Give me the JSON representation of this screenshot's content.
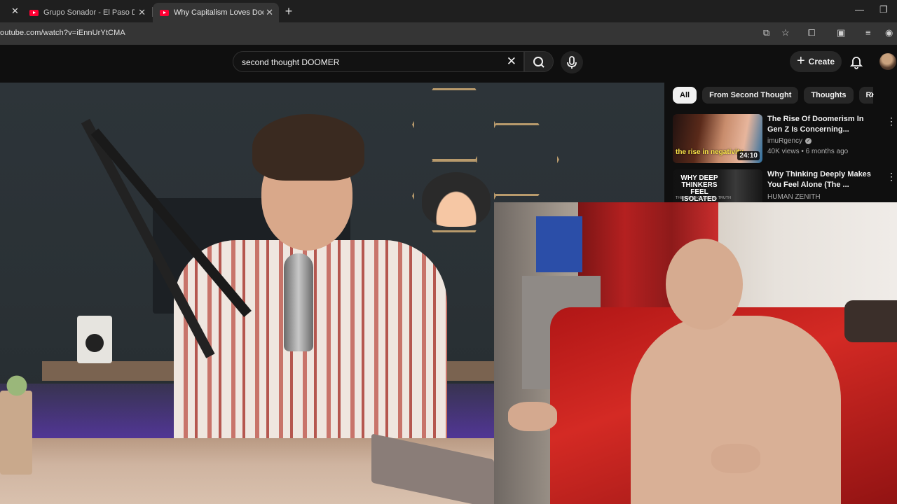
{
  "browser": {
    "tabs": [
      {
        "title": "Grupo Sonador - El Paso Del Gi",
        "active": false
      },
      {
        "title": "Why Capitalism Loves Doomer",
        "active": true
      }
    ],
    "url": "outube.com/watch?v=iEnnUrYtCMA"
  },
  "youtube": {
    "search_value": "second thought DOOMER",
    "create_label": "Create"
  },
  "rail": {
    "chips": [
      "All",
      "From Second Thought",
      "Thoughts",
      "Rela"
    ],
    "recommendations": [
      {
        "title": "The Rise Of Doomerism In Gen Z Is Concerning...",
        "channel": "imuRgency",
        "verified": true,
        "meta": "40K views • 6 months ago",
        "duration": "24:10",
        "thumb_text": "the rise in negativity"
      },
      {
        "title": "Why Thinking Deeply Makes You Feel Alone (The ...",
        "channel": "HUMAN ZENITH",
        "verified": false,
        "thumb_text": "WHY DEEP THINKERS FEEL ISOLATED",
        "thumb_subtext": "THE PSYCHOLOGICAL TRUTH"
      }
    ]
  },
  "colors": {
    "youtube_red": "#ff0033",
    "background": "#0f0f0f",
    "chip_active": "#f1f1f1",
    "chip": "#272727"
  }
}
